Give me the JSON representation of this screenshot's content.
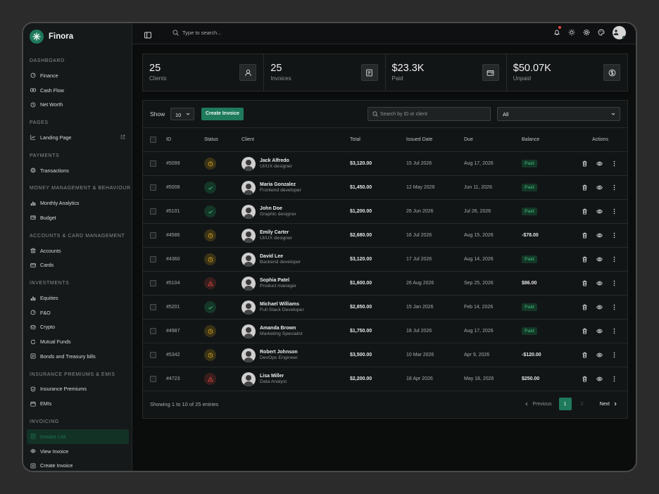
{
  "app": {
    "name": "Finora"
  },
  "colors": {
    "accent": "#1f7a5c",
    "paid_text": "#3fbf7f",
    "pending": "#d9a520",
    "overdue": "#e2483d"
  },
  "sidebar": {
    "sections": [
      {
        "title": "DASHBOARD",
        "items": [
          {
            "label": "Finance",
            "icon": "gauge-icon"
          },
          {
            "label": "Cash Flow",
            "icon": "cash-icon"
          },
          {
            "label": "Net Worth",
            "icon": "clock-icon"
          }
        ]
      },
      {
        "title": "PAGES",
        "items": [
          {
            "label": "Landing Page",
            "icon": "chart-line-icon",
            "external": true
          }
        ]
      },
      {
        "title": "PAYMENTS",
        "items": [
          {
            "label": "Transactions",
            "icon": "coin-icon"
          }
        ]
      },
      {
        "title": "MONEY MANAGEMENT & BEHAVIOUR",
        "items": [
          {
            "label": "Monthly Analytics",
            "icon": "bar-chart-icon"
          },
          {
            "label": "Budget",
            "icon": "wallet-icon"
          }
        ]
      },
      {
        "title": "ACCOUNTS & CARD MANAGEMENT",
        "items": [
          {
            "label": "Accounts",
            "icon": "bank-icon"
          },
          {
            "label": "Cards",
            "icon": "card-icon"
          }
        ]
      },
      {
        "title": "INVESTMENTS",
        "items": [
          {
            "label": "Equities",
            "icon": "bar-chart-icon"
          },
          {
            "label": "F&O",
            "icon": "gauge-icon"
          },
          {
            "label": "Crypto",
            "icon": "coins-icon"
          },
          {
            "label": "Mutual Funds",
            "icon": "refresh-icon"
          },
          {
            "label": "Bonds and Treasury bills",
            "icon": "bond-icon"
          }
        ]
      },
      {
        "title": "INSURANCE PREMIUMS & EMIS",
        "items": [
          {
            "label": "Insurance Premiums",
            "icon": "shield-icon"
          },
          {
            "label": "EMIs",
            "icon": "calendar-icon"
          }
        ]
      },
      {
        "title": "INVOICING",
        "items": [
          {
            "label": "Invoice List",
            "icon": "invoice-icon",
            "active": true
          },
          {
            "label": "View Invoice",
            "icon": "eye-icon"
          },
          {
            "label": "Create Invoice",
            "icon": "plus-icon"
          }
        ]
      }
    ]
  },
  "topbar": {
    "search_placeholder": "Type to search..."
  },
  "stats": [
    {
      "value": "25",
      "label": "Clients",
      "icon": "user-icon"
    },
    {
      "value": "25",
      "label": "Invoices",
      "icon": "invoice-icon"
    },
    {
      "value": "$23.3K",
      "label": "Paid",
      "icon": "wallet-icon"
    },
    {
      "value": "$50.07K",
      "label": "Unpaid",
      "icon": "dollar-icon"
    }
  ],
  "table": {
    "show_label": "Show",
    "show_value": "10",
    "create_label": "Create Invoice",
    "search_placeholder": "Search by ID or client",
    "filter_value": "All",
    "columns": [
      "ID",
      "Status",
      "Client",
      "Total",
      "Issued Date",
      "Due",
      "Balance",
      "Actions"
    ],
    "rows": [
      {
        "id": "#5099",
        "status": "pending",
        "name": "Jack Alfredo",
        "role": "UI/UX designer",
        "total": "$3,120.00",
        "issued": "15 Jul 2026",
        "due": "Aug 17, 2026",
        "balance": "Paid"
      },
      {
        "id": "#5008",
        "status": "paid",
        "name": "Maria Gonzalez",
        "role": "Frontend developer",
        "total": "$1,450.00",
        "issued": "12 May 2026",
        "due": "Jun 11, 2026",
        "balance": "Paid"
      },
      {
        "id": "#5101",
        "status": "paid",
        "name": "John Doe",
        "role": "Graphic designer",
        "total": "$1,200.00",
        "issued": "26 Jun 2026",
        "due": "Jul 26, 2026",
        "balance": "Paid"
      },
      {
        "id": "#4586",
        "status": "pending",
        "name": "Emily Carter",
        "role": "UI/UX designer",
        "total": "$2,680.00",
        "issued": "16 Jul 2026",
        "due": "Aug 15, 2026",
        "balance": "-$78.00"
      },
      {
        "id": "#4360",
        "status": "pending",
        "name": "David Lee",
        "role": "Backend developer",
        "total": "$3,120.00",
        "issued": "17 Jul 2026",
        "due": "Aug 14, 2026",
        "balance": "Paid"
      },
      {
        "id": "#5104",
        "status": "overdue",
        "name": "Sophia Patel",
        "role": "Product manager",
        "total": "$1,600.00",
        "issued": "26 Aug 2026",
        "due": "Sep 25, 2026",
        "balance": "$86.00"
      },
      {
        "id": "#5201",
        "status": "paid",
        "name": "Michael Williams",
        "role": "Full Stack Developer",
        "total": "$2,850.00",
        "issued": "15 Jan 2026",
        "due": "Feb 14, 2026",
        "balance": "Paid"
      },
      {
        "id": "#4987",
        "status": "pending",
        "name": "Amanda Brown",
        "role": "Marketing Specialist",
        "total": "$1,750.00",
        "issued": "18 Jul 2026",
        "due": "Aug 17, 2026",
        "balance": "Paid"
      },
      {
        "id": "#5342",
        "status": "pending",
        "name": "Robert Johnson",
        "role": "DevOps Engineer",
        "total": "$3,500.00",
        "issued": "10 Mar 2026",
        "due": "Apr 9, 2026",
        "balance": "-$120.00"
      },
      {
        "id": "#4723",
        "status": "overdue",
        "name": "Lisa Miller",
        "role": "Data Analyst",
        "total": "$2,200.00",
        "issued": "18 Apr 2026",
        "due": "May 18, 2026",
        "balance": "$250.00"
      }
    ],
    "footer_info": "Showing 1 to 10 of 25 entries",
    "pagination": {
      "prev": "Previous",
      "pages": [
        "1",
        "2"
      ],
      "current": "1",
      "next": "Next"
    }
  }
}
